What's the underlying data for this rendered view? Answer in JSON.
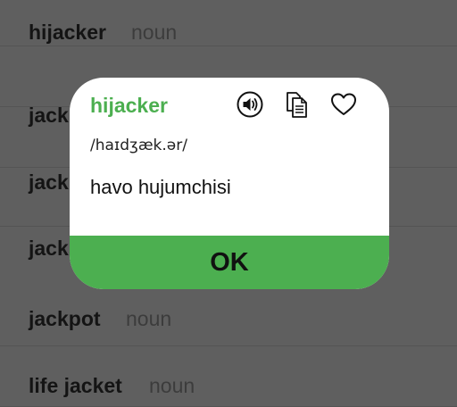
{
  "entries": [
    {
      "word": "hijacker",
      "pos": "noun"
    },
    {
      "word": "jack",
      "pos": ""
    },
    {
      "word": "jack",
      "pos": ""
    },
    {
      "word": "jack",
      "pos": ""
    },
    {
      "word": "jackpot",
      "pos": "noun"
    },
    {
      "word": "life jacket",
      "pos": "noun"
    }
  ],
  "dialog": {
    "word": "hijacker",
    "phonetic": "/haɪdʒæk.ər/",
    "definition": "havo hujumchisi",
    "ok_label": "OK",
    "icons": [
      "speaker-icon",
      "copy-icon",
      "heart-icon"
    ]
  },
  "colors": {
    "accent": "#4caf50",
    "overlay_background": "#5f5f5f",
    "dialog_background": "#ffffff"
  }
}
